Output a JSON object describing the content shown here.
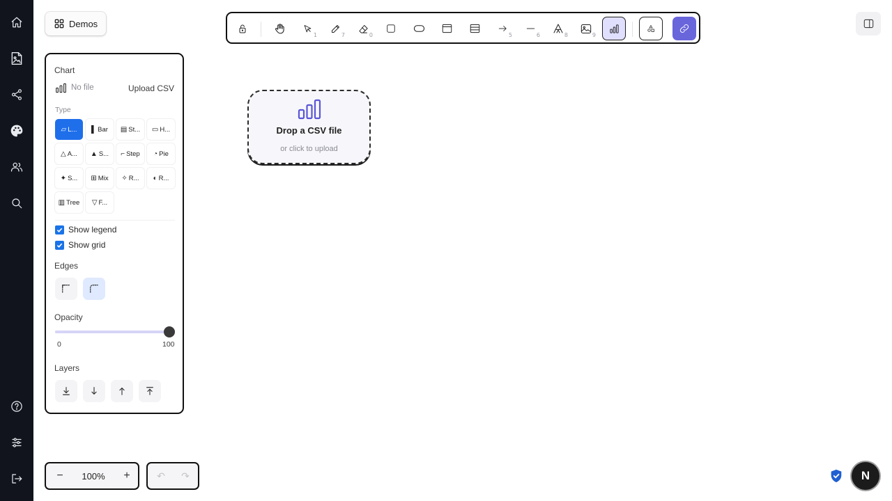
{
  "demos": {
    "label": "Demos",
    "icon": "grid-icon"
  },
  "toolbar": {
    "tools": [
      {
        "name": "lock",
        "key": ""
      },
      {
        "name": "hand",
        "key": ""
      },
      {
        "name": "select",
        "key": "1"
      },
      {
        "name": "draw",
        "key": "7"
      },
      {
        "name": "eraser",
        "key": "0"
      },
      {
        "name": "rectangle",
        "key": ""
      },
      {
        "name": "ellipse",
        "key": ""
      },
      {
        "name": "frame",
        "key": ""
      },
      {
        "name": "table",
        "key": ""
      },
      {
        "name": "arrow",
        "key": "5"
      },
      {
        "name": "line",
        "key": "6"
      },
      {
        "name": "text",
        "key": "8"
      },
      {
        "name": "image",
        "key": "9"
      },
      {
        "name": "chart",
        "key": ""
      }
    ],
    "active_tool": "chart"
  },
  "panel": {
    "section_title": "Chart",
    "file_status": "No file",
    "upload_label": "Upload CSV",
    "type_label": "Type",
    "types": [
      {
        "glyph": "▱",
        "label": "L..."
      },
      {
        "glyph": "▌",
        "label": "Bar"
      },
      {
        "glyph": "▤",
        "label": "St..."
      },
      {
        "glyph": "▭",
        "label": "H..."
      },
      {
        "glyph": "△",
        "label": "A..."
      },
      {
        "glyph": "▲",
        "label": "S..."
      },
      {
        "glyph": "⌐",
        "label": "Step"
      },
      {
        "glyph": "◔",
        "label": "Pie"
      },
      {
        "glyph": "✦",
        "label": "S..."
      },
      {
        "glyph": "⊞",
        "label": "Mix"
      },
      {
        "glyph": "✧",
        "label": "R..."
      },
      {
        "glyph": "◐",
        "label": "R..."
      },
      {
        "glyph": "▥",
        "label": "Tree"
      },
      {
        "glyph": "▽",
        "label": "F..."
      }
    ],
    "selected_type": 0,
    "show_legend_label": "Show legend",
    "show_legend": true,
    "show_grid_label": "Show grid",
    "show_grid": true,
    "edges_label": "Edges",
    "edges_selected": "round",
    "opacity_label": "Opacity",
    "opacity_min": "0",
    "opacity_max": "100",
    "opacity_value": 100,
    "layers_label": "Layers"
  },
  "dropzone": {
    "title": "Drop a CSV file",
    "subtitle": "or click to upload"
  },
  "zoom": {
    "minus": "−",
    "value": "100%",
    "plus": "+"
  },
  "undo": {
    "undo": "↶",
    "redo": "↷"
  },
  "avatar": {
    "initial": "N"
  },
  "colors": {
    "accent": "#6965db",
    "selected": "#1f6feb",
    "rail": "#11141c"
  }
}
